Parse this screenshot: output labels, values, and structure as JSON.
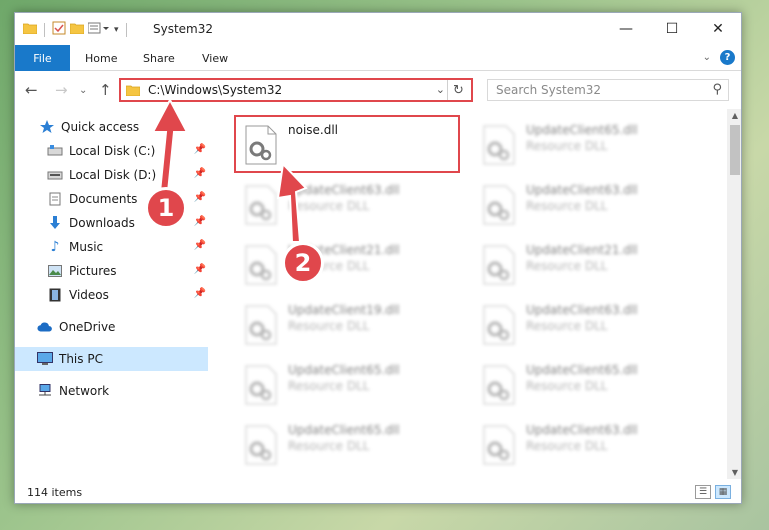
{
  "window": {
    "title": "System32",
    "controls": {
      "minimize": "—",
      "maximize": "☐",
      "close": "✕"
    }
  },
  "ribbon": {
    "tabs": [
      "File",
      "Home",
      "Share",
      "View"
    ],
    "help": "?"
  },
  "address": {
    "path": "C:\\Windows\\System32"
  },
  "search": {
    "placeholder": "Search System32"
  },
  "sidebar": {
    "items": [
      {
        "label": "Quick access",
        "icon": "star-icon"
      },
      {
        "label": "Local Disk (C:)",
        "icon": "drive-icon"
      },
      {
        "label": "Local Disk (D:)",
        "icon": "drive-icon"
      },
      {
        "label": "Documents",
        "icon": "documents-icon"
      },
      {
        "label": "Downloads",
        "icon": "download-icon"
      },
      {
        "label": "Music",
        "icon": "music-icon"
      },
      {
        "label": "Pictures",
        "icon": "pictures-icon"
      },
      {
        "label": "Videos",
        "icon": "videos-icon"
      },
      {
        "label": "OneDrive",
        "icon": "cloud-icon"
      },
      {
        "label": "This PC",
        "icon": "pc-icon"
      },
      {
        "label": "Network",
        "icon": "network-icon"
      }
    ]
  },
  "files": [
    {
      "name": "noise.dll",
      "type": ""
    },
    {
      "name": "UpdateClient65.dll",
      "type": "Resource DLL"
    },
    {
      "name": "UpdateClient63.dll",
      "type": "Resource DLL"
    },
    {
      "name": "UpdateClient63.dll",
      "type": "Resource DLL"
    },
    {
      "name": "UpdateClient21.dll",
      "type": "Resource DLL"
    },
    {
      "name": "UpdateClient21.dll",
      "type": "Resource DLL"
    },
    {
      "name": "UpdateClient19.dll",
      "type": "Resource DLL"
    },
    {
      "name": "UpdateClient63.dll",
      "type": "Resource DLL"
    },
    {
      "name": "UpdateClient65.dll",
      "type": "Resource DLL"
    },
    {
      "name": "UpdateClient65.dll",
      "type": "Resource DLL"
    },
    {
      "name": "UpdateClient65.dll",
      "type": "Resource DLL"
    },
    {
      "name": "UpdateClient63.dll",
      "type": "Resource DLL"
    }
  ],
  "status": {
    "item_count": "114 items"
  },
  "annotations": {
    "badge1": "1",
    "badge2": "2",
    "color": "#e0474c"
  },
  "colors": {
    "accent": "#1979ca",
    "selected": "#cce8ff"
  }
}
